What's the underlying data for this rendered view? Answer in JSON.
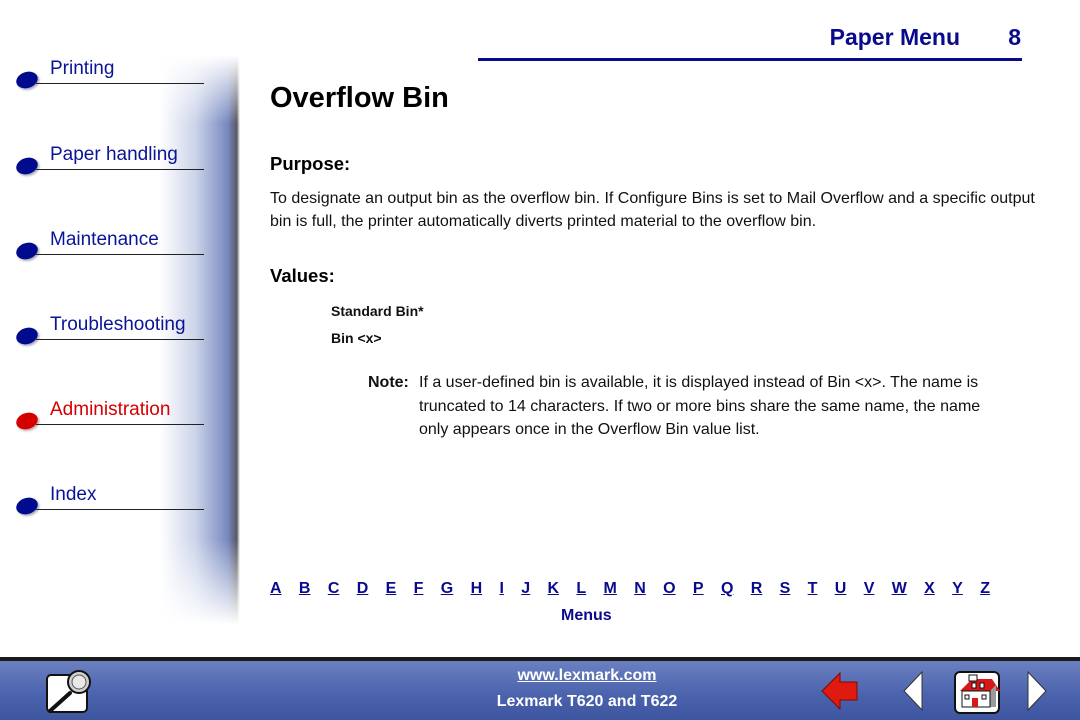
{
  "header": {
    "section_title": "Paper Menu",
    "page_number": "8"
  },
  "sidebar": {
    "items": [
      {
        "label": "Printing",
        "active": false
      },
      {
        "label": "Paper handling",
        "active": false
      },
      {
        "label": "Maintenance",
        "active": false
      },
      {
        "label": "Troubleshooting",
        "active": false
      },
      {
        "label": "Administration",
        "active": true
      },
      {
        "label": "Index",
        "active": false
      }
    ],
    "colors": {
      "link": "#0a1496",
      "active": "#d40000"
    }
  },
  "content": {
    "title": "Overflow Bin",
    "purpose_heading": "Purpose:",
    "purpose_text": "To designate an output bin as the overflow bin. If Configure Bins is set to Mail Overflow and a specific output bin is full, the printer automatically diverts printed material to the overflow bin.",
    "values_heading": "Values:",
    "values": [
      "Standard Bin*",
      "Bin <x>"
    ],
    "note_label": "Note:",
    "note_text": "If a user-defined bin is available, it is displayed instead of Bin <x>. The name is truncated to 14 characters. If two or more bins share the same name, the name only appears once in the Overflow Bin value list."
  },
  "index_nav": {
    "letters": [
      "A",
      "B",
      "C",
      "D",
      "E",
      "F",
      "G",
      "H",
      "I",
      "J",
      "K",
      "L",
      "M",
      "N",
      "O",
      "P",
      "Q",
      "R",
      "S",
      "T",
      "U",
      "V",
      "W",
      "X",
      "Y",
      "Z"
    ],
    "menus_label": "Menus"
  },
  "footer": {
    "url": "www.lexmark.com",
    "product": "Lexmark T620 and T622",
    "icons": [
      "search-icon",
      "back-arrow-icon",
      "previous-page-icon",
      "home-icon",
      "next-page-icon"
    ]
  }
}
